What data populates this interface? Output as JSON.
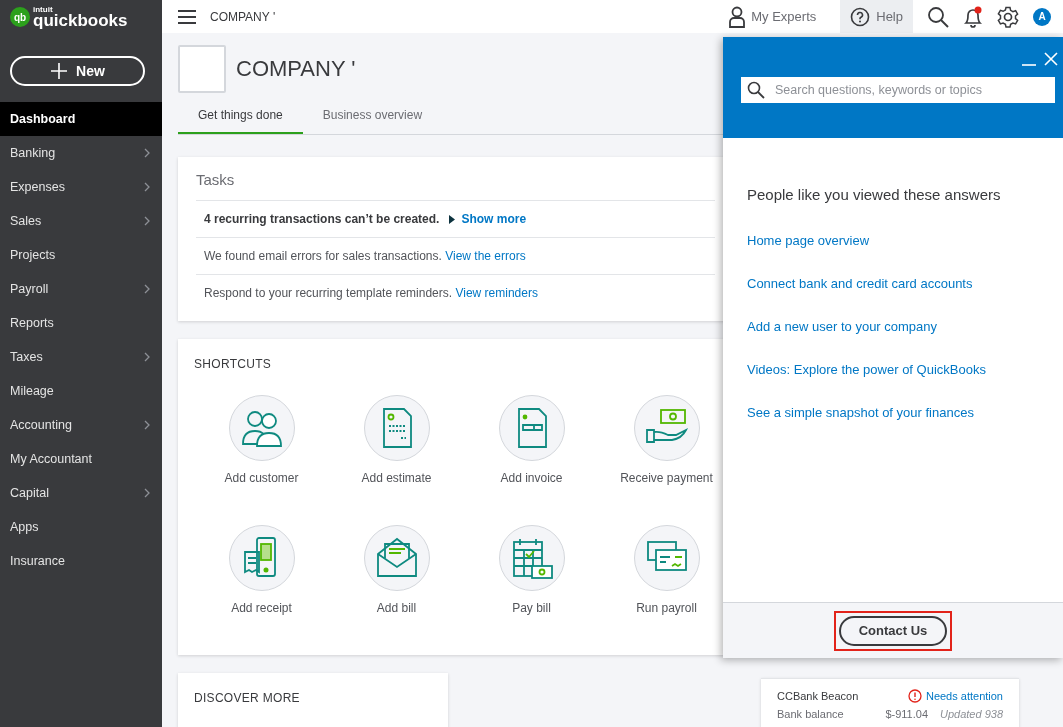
{
  "logo": {
    "badge": "qb",
    "small": "intuit",
    "name": "quickbooks"
  },
  "new_button": {
    "label": "New"
  },
  "sidebar": {
    "items": [
      {
        "label": "Dashboard",
        "selected": true,
        "has_submenu": false
      },
      {
        "label": "Banking",
        "selected": false,
        "has_submenu": true
      },
      {
        "label": "Expenses",
        "selected": false,
        "has_submenu": true
      },
      {
        "label": "Sales",
        "selected": false,
        "has_submenu": true
      },
      {
        "label": "Projects",
        "selected": false,
        "has_submenu": false
      },
      {
        "label": "Payroll",
        "selected": false,
        "has_submenu": true
      },
      {
        "label": "Reports",
        "selected": false,
        "has_submenu": false
      },
      {
        "label": "Taxes",
        "selected": false,
        "has_submenu": true
      },
      {
        "label": "Mileage",
        "selected": false,
        "has_submenu": false
      },
      {
        "label": "Accounting",
        "selected": false,
        "has_submenu": true
      },
      {
        "label": "My Accountant",
        "selected": false,
        "has_submenu": false
      },
      {
        "label": "Capital",
        "selected": false,
        "has_submenu": true
      },
      {
        "label": "Apps",
        "selected": false,
        "has_submenu": false
      },
      {
        "label": "Insurance",
        "selected": false,
        "has_submenu": false
      }
    ]
  },
  "top_bar": {
    "company": "COMPANY '",
    "my_experts": "My Experts",
    "help": {
      "label": "Help",
      "selected": true
    },
    "notifications_unread": true,
    "avatar": "A"
  },
  "company_header": {
    "name": "COMPANY '"
  },
  "tabs": [
    {
      "label": "Get things done",
      "selected": true
    },
    {
      "label": "Business overview",
      "selected": false
    }
  ],
  "tasks": {
    "title": "Tasks",
    "items": [
      {
        "kind": "alert",
        "text": "4 recurring transactions can’t be created.",
        "link": "Show more"
      },
      {
        "kind": "note",
        "text": "We found email errors for sales transactions.",
        "link": "View the errors"
      },
      {
        "kind": "note",
        "text": "Respond to your recurring template reminders.",
        "link": "View reminders"
      }
    ]
  },
  "shortcuts": {
    "title": "SHORTCUTS",
    "items": [
      "Add customer",
      "Add estimate",
      "Add invoice",
      "Receive payment",
      "Add receipt",
      "Add bill",
      "Pay bill",
      "Run payroll"
    ]
  },
  "discover": {
    "title": "DISCOVER MORE"
  },
  "bank_account": {
    "name": "CCBank Beacon",
    "status": "Needs attention",
    "balance_label": "Bank balance",
    "balance": "$-911.04",
    "updated": "Updated 938"
  },
  "help_panel": {
    "search": {
      "placeholder": "Search questions, keywords or topics"
    },
    "heading": "People like you viewed these answers",
    "links": [
      "Home page overview",
      "Connect bank and credit card accounts",
      "Add a new user to your company",
      "Videos: Explore the power of QuickBooks",
      "See a simple snapshot of your finances"
    ],
    "contact_button": {
      "label": "Contact Us",
      "highlighted": true
    }
  }
}
